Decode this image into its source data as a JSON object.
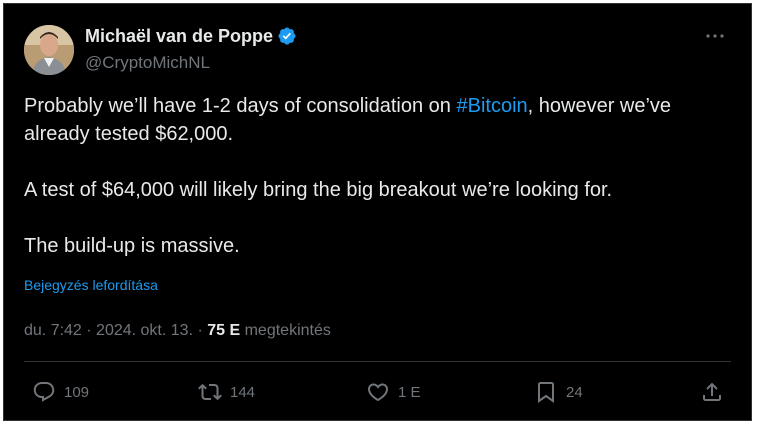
{
  "author": {
    "display_name": "Michaël van de Poppe",
    "handle": "@CryptoMichNL",
    "verified_icon": "verified-badge-icon",
    "verified_color": "#1d9bf0"
  },
  "tweet": {
    "line1_pre": "Probably we’ll have 1-2 days of consolidation on ",
    "hashtag": "#Bitcoin",
    "line1_post": ", however we’ve already tested $62,000.",
    "para2": "A test of $64,000 will likely bring the big breakout we’re looking for.",
    "para3": "The build-up is massive."
  },
  "translate_label": "Bejegyzés lefordítása",
  "meta": {
    "time": "du. 7:42",
    "separator1": " · ",
    "date": "2024. okt. 13.",
    "separator2": " · ",
    "views": "75 E",
    "views_label": " megtekintés"
  },
  "actions": {
    "reply_count": "109",
    "retweet_count": "144",
    "like_count": "1 E",
    "bookmark_count": "24"
  },
  "colors": {
    "background": "#000000",
    "text": "#e7e9ea",
    "muted": "#71767b",
    "accent": "#1d9bf0"
  }
}
